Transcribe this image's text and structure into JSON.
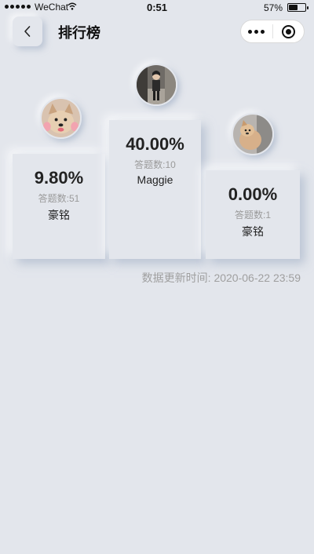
{
  "status_bar": {
    "carrier": "WeChat",
    "time": "0:51",
    "battery": "57%",
    "battery_level": 0.57
  },
  "nav": {
    "title": "排行榜"
  },
  "podium": [
    {
      "rank": 1,
      "percent": "40.00%",
      "count": "答题数:10",
      "name": "Maggie"
    },
    {
      "rank": 2,
      "percent": "9.80%",
      "count": "答题数:51",
      "name": "豪铭"
    },
    {
      "rank": 3,
      "percent": "0.00%",
      "count": "答题数:1",
      "name": "豪铭"
    }
  ],
  "update_time": "数据更新时间: 2020-06-22 23:59",
  "icons": [
    "back-icon",
    "more-icon",
    "target-icon"
  ]
}
